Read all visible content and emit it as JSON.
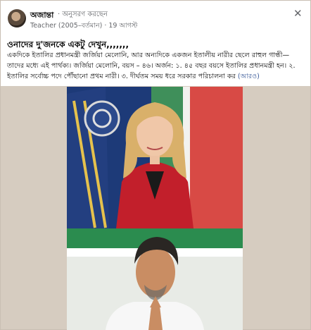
{
  "post": {
    "author": "অজান্তা",
    "follow_label": "অনুসরণ করছেন",
    "role": "Teacher (2005–বর্তমান)",
    "time": "19 আগস্ট",
    "headline": "ওনাদের দু'জনকে একটু দেখুন,,,,,,,",
    "body": "একদিকে ইতালির প্রধানমন্ত্রী জর্জিয়া মেলোনি, আর অন্যদিকে একজন ইতালীয় নারীর ছেলে রাহুল গান্ধী— তাদের মধ্যে এই পার্থক্য। জর্জিয়া মেলোনি, বয়স – ৪৬। অর্জন: ১. ৪৫ বছর বয়সে ইতালির প্রধানমন্ত্রী হন। ২. ইতালির সর্বোচ্চ পদে পৌঁছানো প্রথম নারী। ৩. দীর্ঘতম সময় ধরে সরকার পরিচালনা কর",
    "more": "(আরও)"
  },
  "icons": {
    "close": "close-icon"
  }
}
